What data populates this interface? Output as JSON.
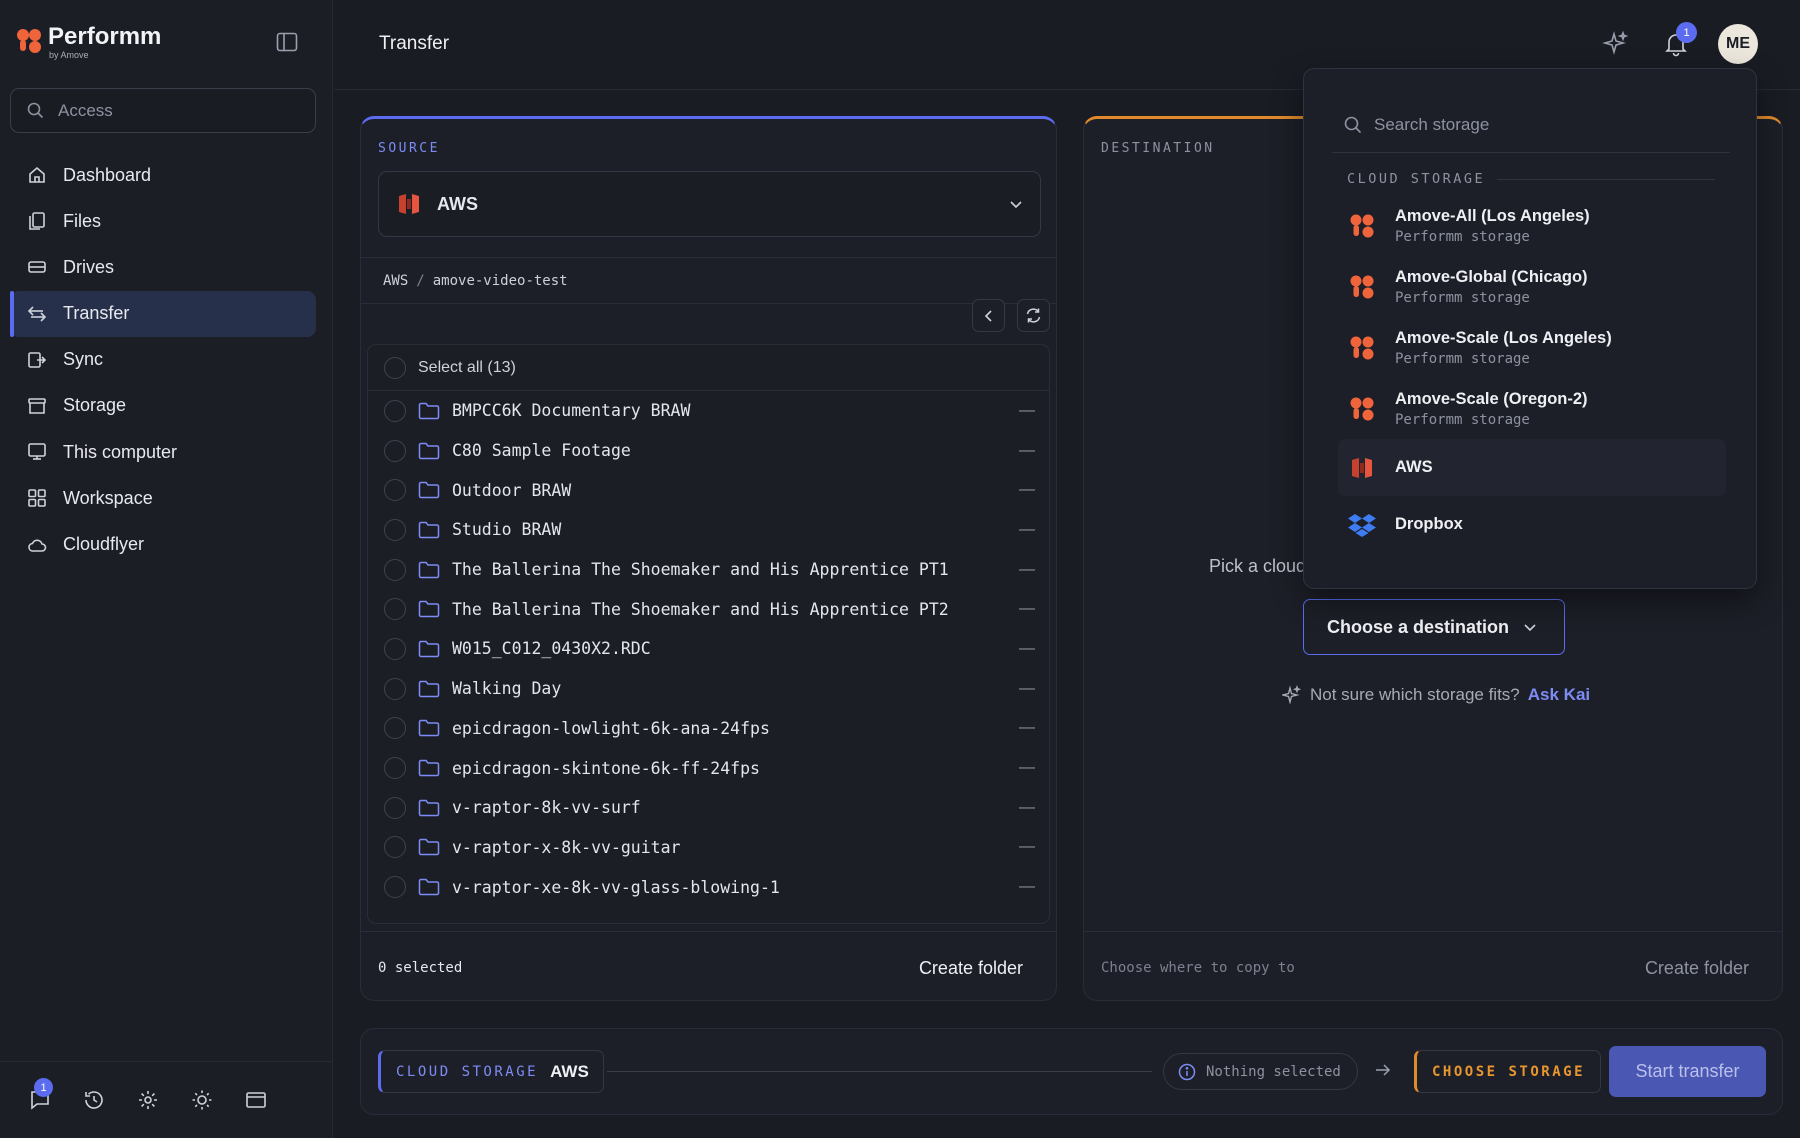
{
  "brand": {
    "name": "Performm",
    "sub": "by Amove"
  },
  "search": {
    "placeholder": "Access"
  },
  "nav": [
    {
      "label": "Dashboard",
      "icon": "home-icon"
    },
    {
      "label": "Files",
      "icon": "files-icon"
    },
    {
      "label": "Drives",
      "icon": "drive-icon"
    },
    {
      "label": "Transfer",
      "icon": "transfer-icon",
      "active": true
    },
    {
      "label": "Sync",
      "icon": "sync-icon"
    },
    {
      "label": "Storage",
      "icon": "storage-icon"
    },
    {
      "label": "This computer",
      "icon": "monitor-icon"
    },
    {
      "label": "Workspace",
      "icon": "grid-icon"
    },
    {
      "label": "Cloudflyer",
      "icon": "cloud-icon"
    }
  ],
  "footer": {
    "chat_badge": "1"
  },
  "header": {
    "title": "Transfer",
    "bell_badge": "1",
    "avatar_initials": "ME"
  },
  "source": {
    "label": "SOURCE",
    "selected": "AWS",
    "breadcrumb": [
      "AWS",
      "amove-video-test"
    ],
    "select_all": "Select all (13)",
    "files": [
      "BMPCC6K Documentary BRAW",
      "C80 Sample Footage",
      "Outdoor BRAW",
      "Studio BRAW",
      "The Ballerina The Shoemaker and His Apprentice PT1",
      "The Ballerina The Shoemaker and His Apprentice PT2",
      "W015_C012_0430X2.RDC",
      "Walking Day",
      "epicdragon-lowlight-6k-ana-24fps",
      "epicdragon-skintone-6k-ff-24fps",
      "v-raptor-8k-vv-surf",
      "v-raptor-x-8k-vv-guitar",
      "v-raptor-xe-8k-vv-glass-blowing-1"
    ],
    "size_placeholder": "—",
    "selected_count": "0 selected",
    "create_folder": "Create folder"
  },
  "destination": {
    "label": "DESTINATION",
    "pick_text": "Pick a cloud",
    "choose_button": "Choose a destination",
    "hint": "Not sure which storage fits?",
    "hint_link": "Ask Kai",
    "footer_text": "Choose where to copy to",
    "create_folder": "Create folder"
  },
  "bottom": {
    "source_label": "CLOUD STORAGE",
    "source_value": "AWS",
    "status": "Nothing selected",
    "dest_label": "CHOOSE STORAGE",
    "start": "Start transfer"
  },
  "dropdown": {
    "search_placeholder": "Search storage",
    "section": "CLOUD STORAGE",
    "items": [
      {
        "name": "Amove-All (Los Angeles)",
        "sub": "Performm storage",
        "icon": "performm-logo-icon"
      },
      {
        "name": "Amove-Global (Chicago)",
        "sub": "Performm storage",
        "icon": "performm-logo-icon"
      },
      {
        "name": "Amove-Scale (Los Angeles)",
        "sub": "Performm storage",
        "icon": "performm-logo-icon"
      },
      {
        "name": "Amove-Scale (Oregon-2)",
        "sub": "Performm storage",
        "icon": "performm-logo-icon"
      },
      {
        "name": "AWS",
        "sub": "",
        "icon": "aws-icon"
      },
      {
        "name": "Dropbox",
        "sub": "",
        "icon": "dropbox-icon"
      }
    ]
  },
  "colors": {
    "accent": "#5b6cf0",
    "orange": "#e08a2c",
    "background": "#1a1c24"
  }
}
